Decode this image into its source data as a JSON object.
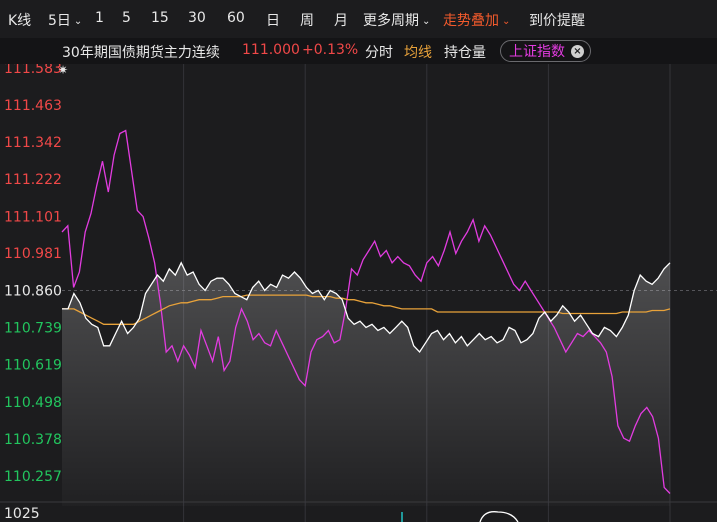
{
  "toolbar": {
    "kline": "K线",
    "period_5d": "5日",
    "p1": "1",
    "p5": "5",
    "p15": "15",
    "p30": "30",
    "p60": "60",
    "day": "日",
    "week": "周",
    "month": "月",
    "more_periods": "更多周期",
    "overlay": "走势叠加",
    "price_alert": "到价提醒"
  },
  "subbar": {
    "instrument": "30年期国债期货主力连续",
    "price": "111.000",
    "change": "+0.13%",
    "fenshi": "分时",
    "avg_line": "均线",
    "open_interest": "持仓量",
    "overlay_index": "上证指数"
  },
  "colors": {
    "up": "#f04848",
    "down": "#22c55e",
    "price_line": "#ffffff",
    "avg_line": "#e8a23a",
    "overlay_line": "#e23ce0",
    "accent": "#f25a2c"
  },
  "chart_data": {
    "type": "line",
    "y_ticks": [
      "111.583",
      "111.463",
      "111.342",
      "111.222",
      "111.101",
      "110.981",
      "110.860",
      "110.739",
      "110.619",
      "110.498",
      "110.378",
      "110.257"
    ],
    "ylim": [
      110.257,
      111.583
    ],
    "y_tick_up_count": 6,
    "baseline": 110.86,
    "volume_axis_label": "1025",
    "days": 5,
    "series": [
      {
        "name": "30年期国债期货主力连续",
        "role": "price",
        "values": [
          110.8,
          110.8,
          110.85,
          110.82,
          110.77,
          110.75,
          110.74,
          110.68,
          110.68,
          110.72,
          110.76,
          110.72,
          110.74,
          110.77,
          110.85,
          110.88,
          110.91,
          110.89,
          110.93,
          110.91,
          110.95,
          110.91,
          110.92,
          110.88,
          110.86,
          110.89,
          110.9,
          110.9,
          110.88,
          110.85,
          110.84,
          110.83,
          110.87,
          110.89,
          110.86,
          110.88,
          110.87,
          110.91,
          110.9,
          110.92,
          110.9,
          110.87,
          110.85,
          110.86,
          110.83,
          110.86,
          110.85,
          110.83,
          110.77,
          110.75,
          110.76,
          110.74,
          110.75,
          110.73,
          110.74,
          110.72,
          110.74,
          110.76,
          110.74,
          110.68,
          110.66,
          110.69,
          110.72,
          110.73,
          110.7,
          110.72,
          110.69,
          110.71,
          110.68,
          110.7,
          110.72,
          110.7,
          110.71,
          110.69,
          110.7,
          110.74,
          110.73,
          110.69,
          110.7,
          110.72,
          110.77,
          110.79,
          110.76,
          110.78,
          110.81,
          110.79,
          110.76,
          110.78,
          110.75,
          110.72,
          110.71,
          110.74,
          110.73,
          110.71,
          110.74,
          110.78,
          110.86,
          110.91,
          110.89,
          110.88,
          110.9,
          110.93,
          110.95
        ]
      },
      {
        "name": "均线",
        "role": "average",
        "values": [
          110.8,
          110.8,
          110.8,
          110.79,
          110.78,
          110.77,
          110.76,
          110.75,
          110.75,
          110.75,
          110.75,
          110.75,
          110.75,
          110.76,
          110.77,
          110.78,
          110.79,
          110.8,
          110.81,
          110.815,
          110.82,
          110.82,
          110.825,
          110.83,
          110.83,
          110.83,
          110.835,
          110.84,
          110.84,
          110.84,
          110.84,
          110.845,
          110.845,
          110.845,
          110.845,
          110.845,
          110.845,
          110.845,
          110.845,
          110.845,
          110.845,
          110.845,
          110.84,
          110.84,
          110.84,
          110.84,
          110.835,
          110.835,
          110.83,
          110.83,
          110.825,
          110.82,
          110.82,
          110.815,
          110.81,
          110.81,
          110.805,
          110.8,
          110.8,
          110.8,
          110.8,
          110.8,
          110.8,
          110.79,
          110.79,
          110.79,
          110.79,
          110.79,
          110.79,
          110.79,
          110.79,
          110.79,
          110.79,
          110.79,
          110.79,
          110.79,
          110.79,
          110.79,
          110.79,
          110.79,
          110.79,
          110.79,
          110.79,
          110.79,
          110.785,
          110.785,
          110.785,
          110.785,
          110.785,
          110.785,
          110.785,
          110.785,
          110.785,
          110.785,
          110.79,
          110.79,
          110.79,
          110.79,
          110.79,
          110.795,
          110.795,
          110.795,
          110.8
        ]
      },
      {
        "name": "上证指数",
        "role": "overlay",
        "values": [
          111.05,
          111.07,
          110.87,
          110.92,
          111.05,
          111.11,
          111.2,
          111.28,
          111.18,
          111.3,
          111.37,
          111.38,
          111.25,
          111.12,
          111.1,
          111.03,
          110.95,
          110.82,
          110.66,
          110.68,
          110.63,
          110.68,
          110.65,
          110.61,
          110.73,
          110.68,
          110.63,
          110.71,
          110.6,
          110.63,
          110.74,
          110.8,
          110.76,
          110.7,
          110.72,
          110.69,
          110.68,
          110.73,
          110.69,
          110.65,
          110.61,
          110.57,
          110.55,
          110.66,
          110.7,
          110.71,
          110.73,
          110.69,
          110.7,
          110.8,
          110.93,
          110.91,
          110.96,
          110.99,
          111.02,
          110.97,
          110.99,
          110.95,
          110.97,
          110.95,
          110.94,
          110.91,
          110.89,
          110.95,
          110.97,
          110.94,
          110.99,
          111.05,
          110.98,
          111.02,
          111.05,
          111.09,
          111.02,
          111.07,
          111.04,
          111.0,
          110.96,
          110.92,
          110.88,
          110.86,
          110.89,
          110.86,
          110.83,
          110.8,
          110.77,
          110.74,
          110.7,
          110.66,
          110.69,
          110.72,
          110.71,
          110.73,
          110.71,
          110.69,
          110.66,
          110.58,
          110.42,
          110.38,
          110.37,
          110.42,
          110.46,
          110.48,
          110.45,
          110.38,
          110.22,
          110.2
        ]
      }
    ]
  }
}
